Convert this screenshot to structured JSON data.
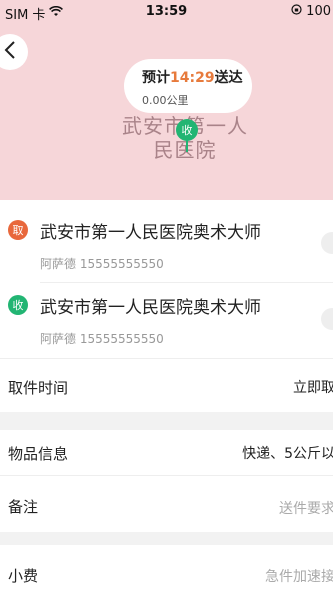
{
  "status_bar": {
    "carrier": "SIM 卡",
    "time": "13:59",
    "battery": "100"
  },
  "map": {
    "eta_prefix": "预计",
    "eta_time": "14:29",
    "eta_suffix": "送达",
    "distance": "0.00公里",
    "place_label": "武安市第一人民医院",
    "pin_label": "收"
  },
  "pickup": {
    "badge": "取",
    "title": "武安市第一人民医院奥术大师",
    "contact": "阿萨德 15555555550"
  },
  "delivery": {
    "badge": "收",
    "title": "武安市第一人民医院奥术大师",
    "contact": "阿萨德 15555555550"
  },
  "rows": {
    "pickup_time": {
      "label": "取件时间",
      "value": "立即取"
    },
    "item_info": {
      "label": "物品信息",
      "value": "快递、5公斤以"
    },
    "remark": {
      "label": "备注",
      "placeholder": "送件要求"
    },
    "tip": {
      "label": "小费",
      "placeholder": "急件加速接"
    }
  },
  "colors": {
    "map_bg": "#f6d6d9",
    "pickup_badge": "#e8683c",
    "delivery_badge": "#22b573",
    "eta_accent": "#e77a3c"
  }
}
